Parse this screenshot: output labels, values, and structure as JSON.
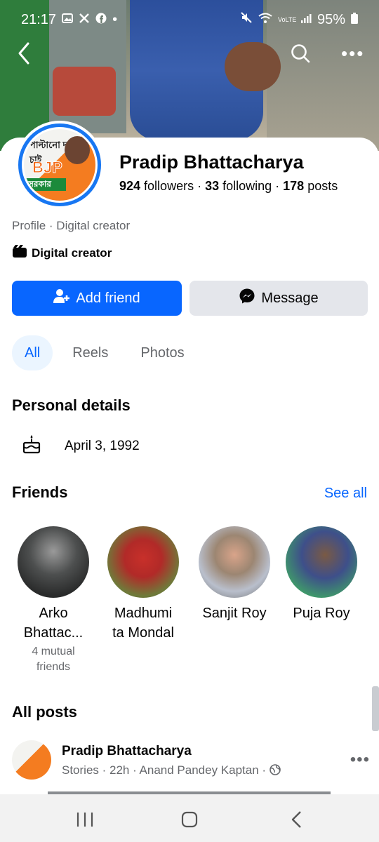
{
  "status": {
    "time": "21:17",
    "left_icons": [
      "image-icon",
      "x-icon",
      "facebook-icon"
    ],
    "dot": "•",
    "battery": "95%",
    "lte": "VoLTE"
  },
  "profile": {
    "name": "Pradip Bhattacharya",
    "followers_count": "924",
    "followers_label": " followers · ",
    "following_count": "33",
    "following_label": " following · ",
    "posts_count": "178",
    "posts_label": " posts",
    "subtitle": "Profile · Digital creator",
    "category": "Digital creator",
    "avatar_text_top": "পাল্টানো দরকার চাই",
    "avatar_text_bjp": "BJP",
    "avatar_text_bottom": "সরকার"
  },
  "actions": {
    "add_friend": "Add friend",
    "message": "Message"
  },
  "tabs": [
    {
      "label": "All",
      "active": true
    },
    {
      "label": "Reels",
      "active": false
    },
    {
      "label": "Photos",
      "active": false
    }
  ],
  "personal_details": {
    "title": "Personal details",
    "birthday": "April 3, 1992"
  },
  "friends": {
    "title": "Friends",
    "see_all": "See all",
    "items": [
      {
        "name": "Arko Bhattac...",
        "mutual": "4 mutual friends"
      },
      {
        "name": "Madhumi ta Mondal",
        "mutual": ""
      },
      {
        "name": "Sanjit Roy",
        "mutual": ""
      },
      {
        "name": "Puja Roy",
        "mutual": ""
      }
    ]
  },
  "posts": {
    "title": "All posts",
    "first": {
      "author": "Pradip Bhattacharya",
      "meta": "Stories · 22h ·  Anand Pandey Kaptan ·"
    }
  },
  "colors": {
    "accent": "#0866ff",
    "secondary_btn": "#e4e6eb",
    "muted_text": "#65676b",
    "avatar_ring": "#1877f2"
  }
}
